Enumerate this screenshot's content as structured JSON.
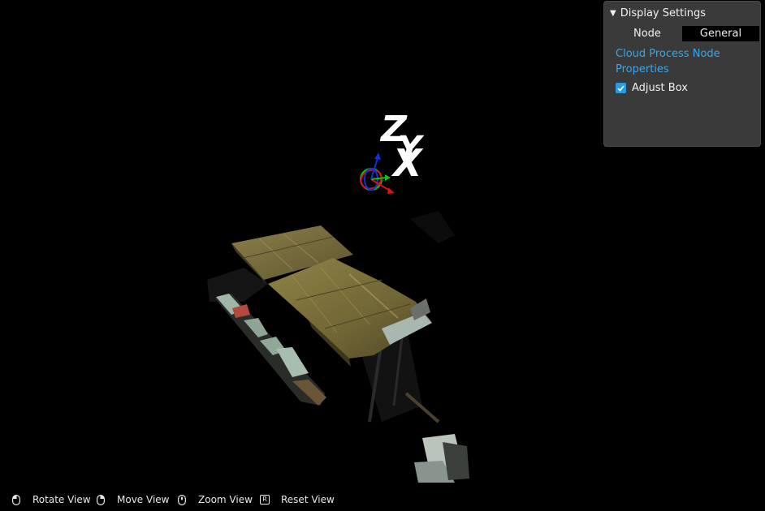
{
  "viewport": {
    "axis_labels": {
      "z": "Z",
      "y": "Y",
      "x": "X"
    }
  },
  "panel": {
    "title": "Display Settings",
    "node_label": "Node",
    "node_value": "General",
    "properties_link": "Cloud Process Node Properties",
    "adjust_box": {
      "label": "Adjust Box",
      "checked": true
    }
  },
  "hints": {
    "rotate": {
      "label": "Rotate View",
      "icon": "mouse-left-icon"
    },
    "move": {
      "label": "Move View",
      "icon": "mouse-right-icon"
    },
    "zoom": {
      "label": "Zoom View",
      "icon": "mouse-wheel-icon"
    },
    "reset": {
      "label": "Reset View",
      "icon": "key-r-icon",
      "key": "R"
    }
  },
  "colors": {
    "background": "#000000",
    "panel_bg": "#3a3a3a",
    "link": "#3aa6e8",
    "checkbox": "#2c9be0",
    "axis_x": "#e01010",
    "axis_y": "#10c010",
    "axis_z": "#1030e0"
  }
}
